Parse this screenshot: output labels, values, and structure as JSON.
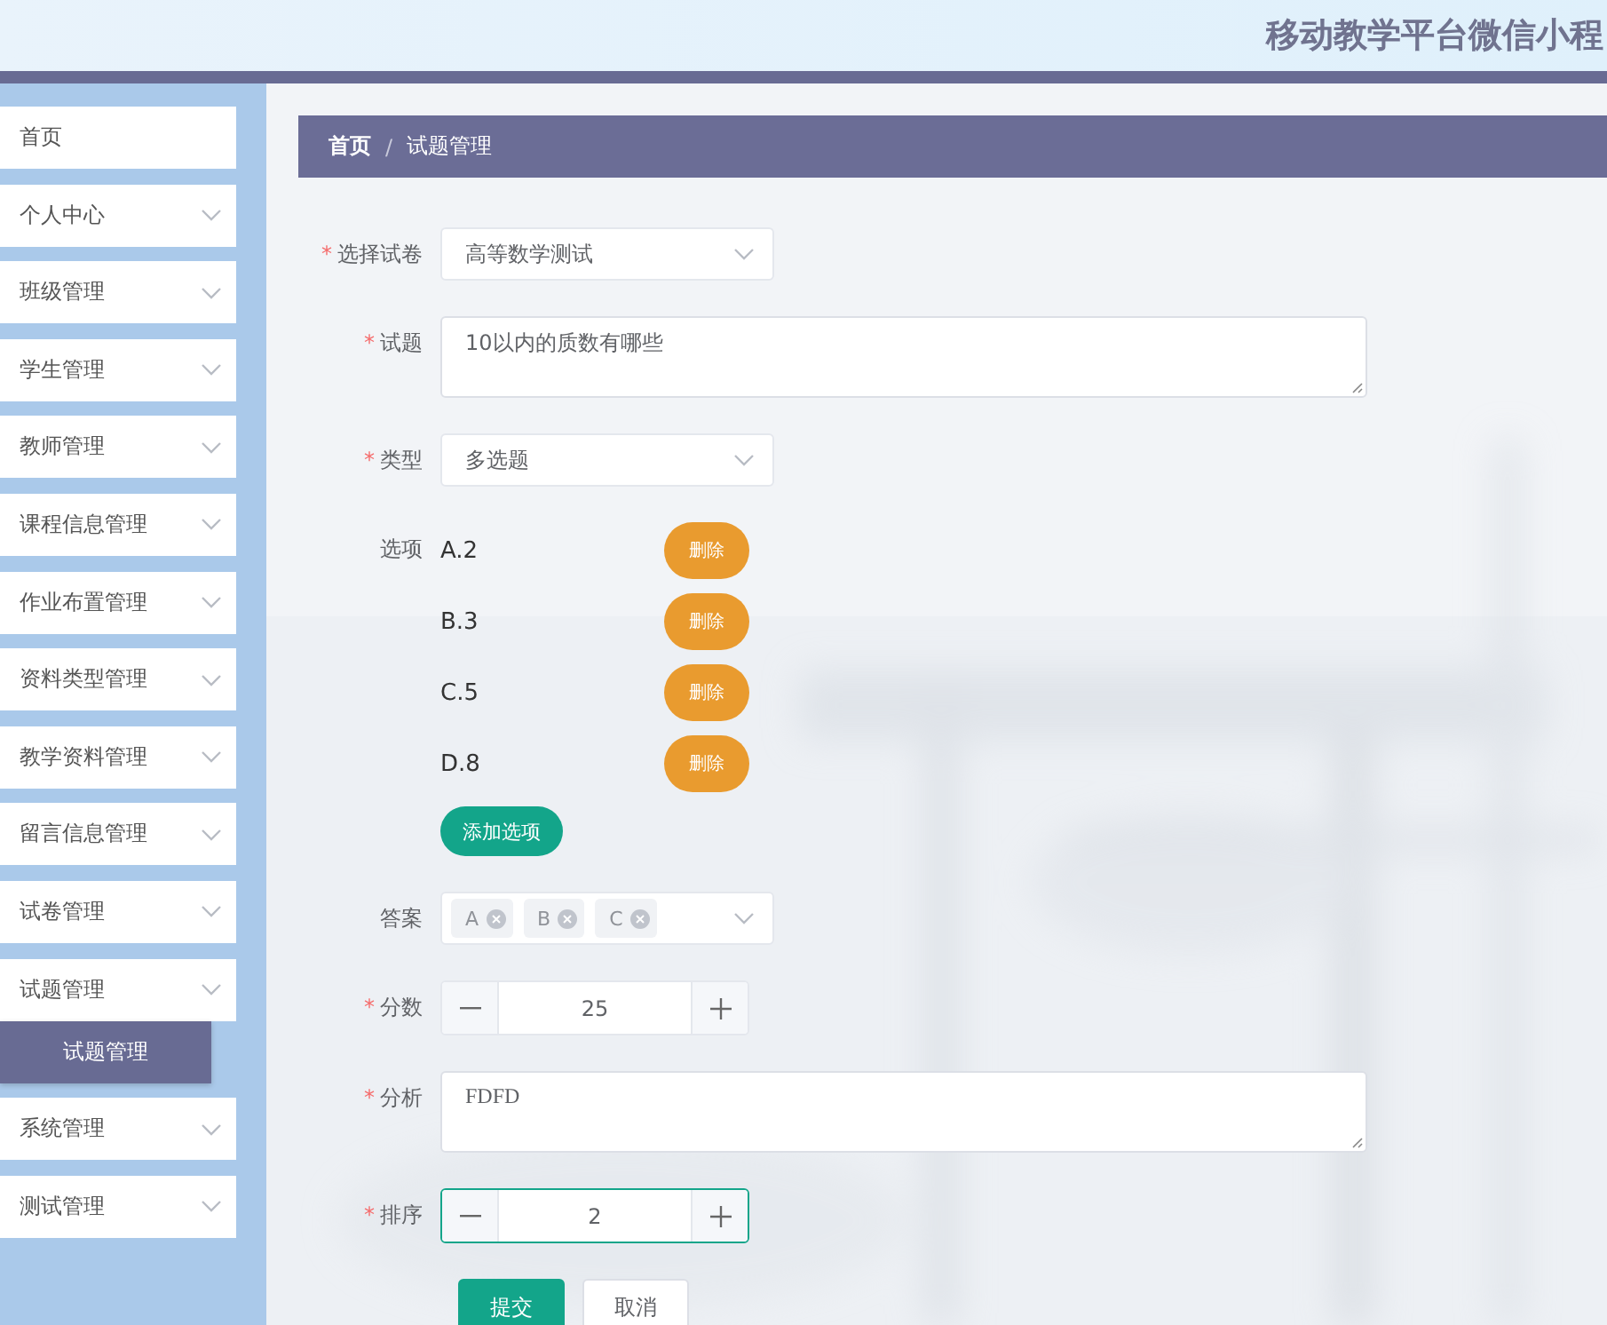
{
  "header": {
    "title": "移动教学平台微信小程"
  },
  "sidebar": {
    "items": [
      {
        "label": "首页",
        "has_submenu": false
      },
      {
        "label": "个人中心",
        "has_submenu": true
      },
      {
        "label": "班级管理",
        "has_submenu": true
      },
      {
        "label": "学生管理",
        "has_submenu": true
      },
      {
        "label": "教师管理",
        "has_submenu": true
      },
      {
        "label": "课程信息管理",
        "has_submenu": true
      },
      {
        "label": "作业布置管理",
        "has_submenu": true
      },
      {
        "label": "资料类型管理",
        "has_submenu": true
      },
      {
        "label": "教学资料管理",
        "has_submenu": true
      },
      {
        "label": "留言信息管理",
        "has_submenu": true
      },
      {
        "label": "试卷管理",
        "has_submenu": true
      },
      {
        "label": "试题管理",
        "has_submenu": true,
        "children": [
          {
            "label": "试题管理",
            "selected": true
          }
        ]
      },
      {
        "label": "系统管理",
        "has_submenu": true
      },
      {
        "label": "测试管理",
        "has_submenu": true
      }
    ]
  },
  "breadcrumb": {
    "separator": "/",
    "items": [
      "首页",
      "试题管理"
    ]
  },
  "form": {
    "fields": [
      {
        "kind": "select",
        "label": "选择试卷",
        "required_mark": "*",
        "value": "高等数学测试"
      },
      {
        "kind": "textarea",
        "label": "试题",
        "required_mark": "*",
        "value": "10以内的质数有哪些"
      },
      {
        "kind": "select",
        "label": "类型",
        "required_mark": "*",
        "value": "多选题"
      },
      {
        "kind": "options",
        "label": "选项",
        "options": [
          {
            "text": "A.2",
            "button": "删除"
          },
          {
            "text": "B.3",
            "button": "删除"
          },
          {
            "text": "C.5",
            "button": "删除"
          },
          {
            "text": "D.8",
            "button": "删除"
          }
        ],
        "add_button": "添加选项"
      },
      {
        "kind": "multiselect",
        "label": "答案",
        "tags": [
          "A",
          "B",
          "C"
        ]
      },
      {
        "kind": "number",
        "label": "分数",
        "required_mark": "*",
        "value": "25",
        "focused": false
      },
      {
        "kind": "textarea",
        "label": "分析",
        "required_mark": "*",
        "value": "FDFD"
      },
      {
        "kind": "number",
        "label": "排序",
        "required_mark": "*",
        "value": "2",
        "focused": true
      }
    ],
    "buttons": [
      {
        "label": "提交",
        "kind": "primary"
      },
      {
        "label": "取消",
        "kind": "default"
      }
    ]
  }
}
